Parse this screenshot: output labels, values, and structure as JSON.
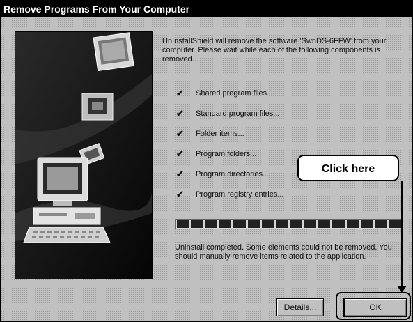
{
  "window": {
    "title": "Remove Programs From Your Computer"
  },
  "message": "UnInstallShield will remove the software 'SwnDS-6FFW' from your computer. Please wait while each of the following components is removed...",
  "checklist": {
    "check_glyph": "✔",
    "items": [
      {
        "label": "Shared program files..."
      },
      {
        "label": "Standard program files..."
      },
      {
        "label": "Folder items..."
      },
      {
        "label": "Program folders..."
      },
      {
        "label": "Program directories..."
      },
      {
        "label": "Program registry entries..."
      }
    ]
  },
  "progress": {
    "value": 1.0,
    "block_count": 16
  },
  "status": "Uninstall completed. Some elements could not be removed. You should manually remove items related to the application.",
  "buttons": {
    "details": "Details...",
    "ok": "OK"
  },
  "callout": {
    "text": "Click here"
  },
  "colors": {
    "titlebar_bg": "#000000",
    "dialog_bg": "#c0c0c0"
  }
}
